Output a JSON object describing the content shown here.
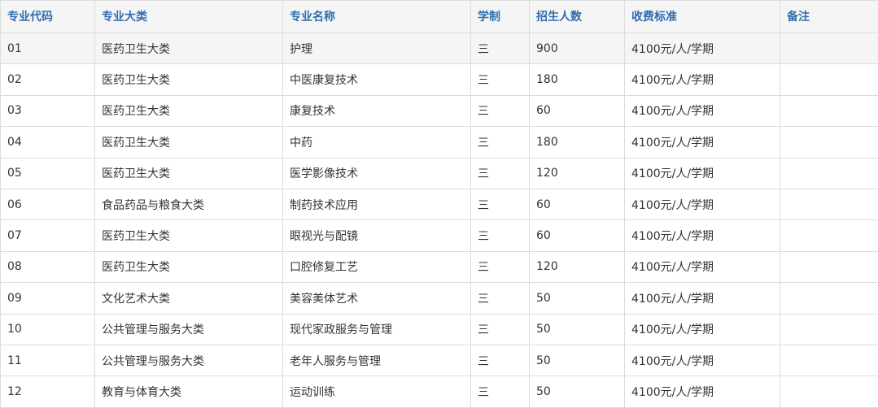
{
  "table": {
    "headers": [
      "专业代码",
      "专业大类",
      "专业名称",
      "学制",
      "招生人数",
      "收费标准",
      "备注"
    ],
    "rows": [
      [
        "01",
        "医药卫生大类",
        "护理",
        "三",
        "900",
        "4100元/人/学期",
        ""
      ],
      [
        "02",
        "医药卫生大类",
        "中医康复技术",
        "三",
        "180",
        "4100元/人/学期",
        ""
      ],
      [
        "03",
        "医药卫生大类",
        "康复技术",
        "三",
        "60",
        "4100元/人/学期",
        ""
      ],
      [
        "04",
        "医药卫生大类",
        "中药",
        "三",
        "180",
        "4100元/人/学期",
        ""
      ],
      [
        "05",
        "医药卫生大类",
        "医学影像技术",
        "三",
        "120",
        "4100元/人/学期",
        ""
      ],
      [
        "06",
        "食品药品与粮食大类",
        "制药技术应用",
        "三",
        "60",
        "4100元/人/学期",
        ""
      ],
      [
        "07",
        "医药卫生大类",
        "眼视光与配镜",
        "三",
        "60",
        "4100元/人/学期",
        ""
      ],
      [
        "08",
        "医药卫生大类",
        "口腔修复工艺",
        "三",
        "120",
        "4100元/人/学期",
        ""
      ],
      [
        "09",
        "文化艺术大类",
        "美容美体艺术",
        "三",
        "50",
        "4100元/人/学期",
        ""
      ],
      [
        "10",
        "公共管理与服务大类",
        "现代家政服务与管理",
        "三",
        "50",
        "4100元/人/学期",
        ""
      ],
      [
        "11",
        "公共管理与服务大类",
        "老年人服务与管理",
        "三",
        "50",
        "4100元/人/学期",
        ""
      ],
      [
        "12",
        "教育与体育大类",
        "运动训练",
        "三",
        "50",
        "4100元/人/学期",
        ""
      ]
    ]
  },
  "colors": {
    "header_text": "#2e6dae",
    "header_bg": "#f5f5f5",
    "highlight_row_bg": "#f5f5f5",
    "border": "#dcdcdc",
    "cell_text": "#333333"
  }
}
